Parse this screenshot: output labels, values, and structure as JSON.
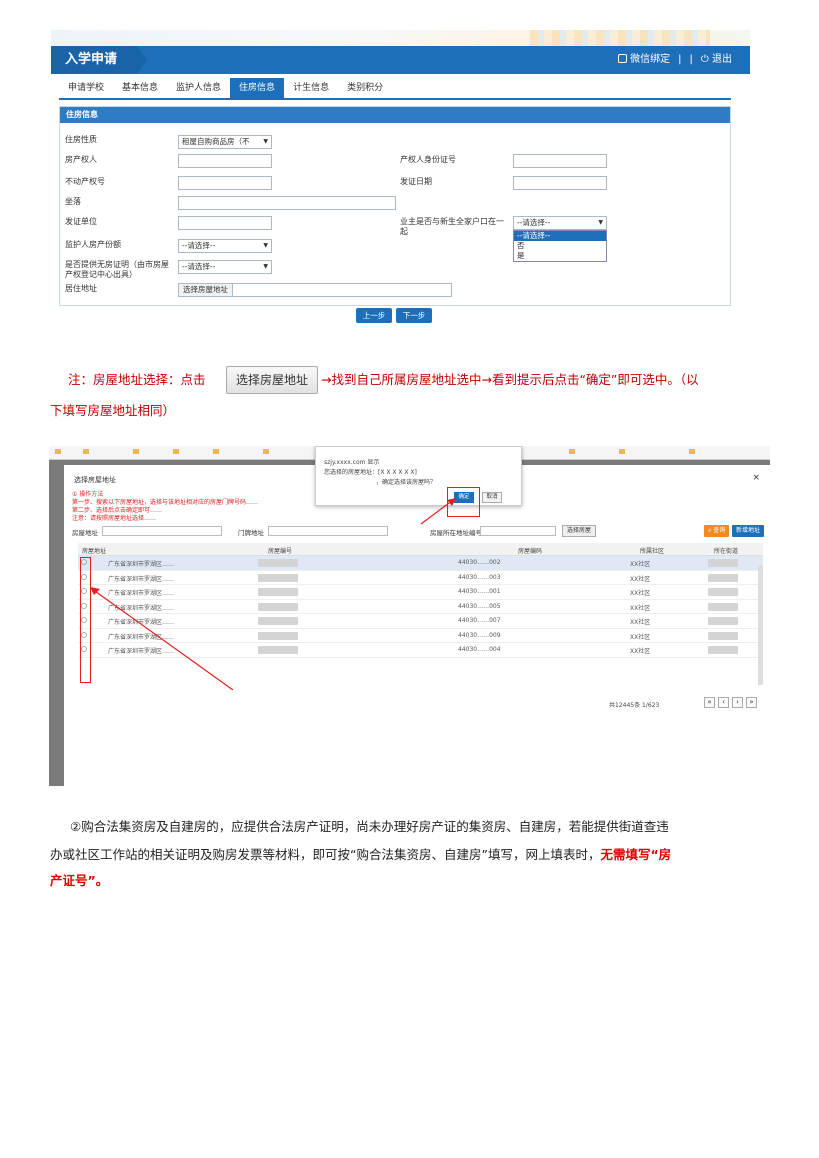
{
  "screenshot1": {
    "header_title": "入学申请",
    "wechat": "微信绑定",
    "sep1": "|",
    "sep2": "|",
    "logout": "退出",
    "tabs": [
      "申请学校",
      "基本信息",
      "监护人信息",
      "住房信息",
      "计生信息",
      "类别积分"
    ],
    "active_tab": "住房信息",
    "panel_title": "住房信息",
    "fields": {
      "housing_nature": "住房性质",
      "housing_nature_value": "租屋自购商品房（不",
      "owner": "房产权人",
      "owner_id": "产权人身份证号",
      "cert_no": "不动产权号",
      "issue_date": "发证日期",
      "location": "坐落",
      "issuer": "发证单位",
      "same_hukou": "业主是否与新生全家户口在一起",
      "guardian_share": "监护人房产份额",
      "no_house_proof": "是否提供无房证明（由市房屋产权登记中心出具）",
      "address": "居住地址"
    },
    "select_placeholder": "--请选择--",
    "dropdown_options": [
      "--请选择--",
      "否",
      "是"
    ],
    "select_address_btn": "选择房屋地址",
    "prev": "上一步",
    "next": "下一步"
  },
  "note": {
    "part1": "注：房屋地址选择：点击",
    "button": "选择房屋地址",
    "part2": "→找到自己所属房屋地址选中→看到提示后点击“确定”即可选中。（以",
    "line2": "下填写房屋地址相同）"
  },
  "screenshot2": {
    "dialog_title": "选择房屋地址",
    "close": "×",
    "steps": [
      "① 操作方法",
      "第一步、搜索以下房屋地址，选择与该地址相对应的房屋门牌号码……",
      "第二步、选择后点击确定即可……",
      "注意：请按照房屋地址选择……"
    ],
    "search_label1": "房屋地址",
    "search_label2": "门牌地址",
    "search_label3": "房屋所在地址编号",
    "search_btn": "选择房屋",
    "query_btn": "查询",
    "reset_btn": "新增地址",
    "columns": [
      "房屋地址",
      "房屋编号",
      "房屋编码",
      "所属社区",
      "所在街道"
    ],
    "rows": [
      {
        "addr": "广东省深圳市罗湖区……",
        "code": "44030……002",
        "comm": "XX社区"
      },
      {
        "addr": "广东省深圳市罗湖区……",
        "code": "44030……003",
        "comm": "XX社区"
      },
      {
        "addr": "广东省深圳市罗湖区……",
        "code": "44030……001",
        "comm": "XX社区"
      },
      {
        "addr": "广东省深圳市罗湖区……",
        "code": "44030……005",
        "comm": "XX社区"
      },
      {
        "addr": "广东省深圳市罗湖区……",
        "code": "44030……007",
        "comm": "XX社区"
      },
      {
        "addr": "广东省深圳市罗湖区……",
        "code": "44030……009",
        "comm": "XX社区"
      },
      {
        "addr": "广东省深圳市罗湖区……",
        "code": "44030……004",
        "comm": "XX社区"
      }
    ],
    "pager": "共12445条 1/623",
    "popup_host": "szjy.xxxx.com 显示",
    "popup_msg1": "您选择的房屋地址：[X X X X X X]",
    "popup_msg2": "，确定选择该房屋吗？",
    "ok": "确定",
    "cancel": "取消"
  },
  "paragraph": {
    "line1": "②购合法集资房及自建房的，应提供合法房产证明，尚未办理好房产证的集资房、自建房，若能提供街道查违",
    "line2_a": "办或社区工作站的相关证明及购房发票等材料，即可按“购合法集资房、自建房”填写，网上填表时，",
    "line2_b": "无需填写“房",
    "line3": "产证号”。"
  }
}
